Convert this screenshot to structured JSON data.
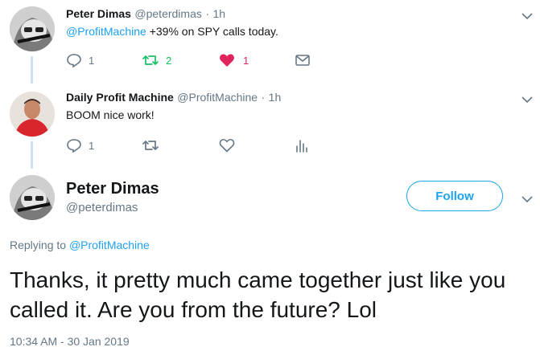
{
  "tweet1": {
    "name": "Peter Dimas",
    "handle": "@peterdimas",
    "separator": "·",
    "time": "1h",
    "mention": "@ProfitMachine",
    "text": "+39% on SPY calls today.",
    "replies": "1",
    "retweets": "2",
    "likes": "1",
    "colors": {
      "retweet": "#17bf63",
      "like": "#e0245e"
    }
  },
  "tweet2": {
    "name": "Daily Profit Machine",
    "handle": "@ProfitMachine",
    "separator": "·",
    "time": "1h",
    "text": "BOOM nice work!",
    "replies": "1"
  },
  "main": {
    "name": "Peter Dimas",
    "handle": "@peterdimas",
    "follow_label": "Follow",
    "replying_prefix": "Replying to",
    "replying_to": "@ProfitMachine",
    "text": "Thanks, it pretty much came together just like you called it. Are you from the future? Lol",
    "timestamp": "10:34 AM - 30 Jan 2019"
  },
  "icons": {
    "reply": "reply-icon",
    "retweet": "retweet-icon",
    "like": "heart-icon",
    "dm": "envelope-icon",
    "analytics": "analytics-icon",
    "more": "chevron-down-icon"
  },
  "accent": "#1da1f2"
}
